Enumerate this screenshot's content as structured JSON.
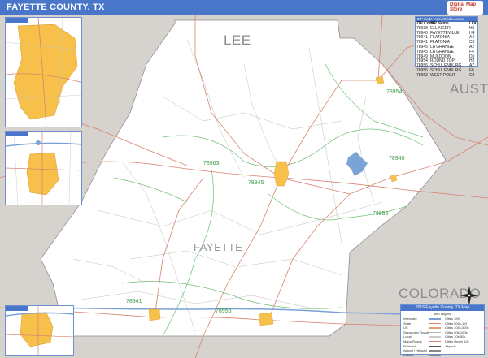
{
  "header": {
    "title": "FAYETTE COUNTY, TX"
  },
  "logo": {
    "text": "Digital Map Store"
  },
  "regions": [
    {
      "name": "LEE"
    },
    {
      "name": "AUSTIN"
    },
    {
      "name": "COLORADO"
    }
  ],
  "county": {
    "name": "FAYETTE"
  },
  "zip_codes_on_map": [
    "78954",
    "78963",
    "78945",
    "78940",
    "78956",
    "78941",
    "78956"
  ],
  "zip_table": {
    "title": "ZIP Code Index/Grid Locator",
    "headers": [
      "ZIP Code",
      "ZIP Name",
      "LOC"
    ],
    "rows": [
      [
        "78938",
        "ELLINGER",
        "H5"
      ],
      [
        "78940",
        "FAYETTEVILLE",
        "H4"
      ],
      [
        "78941",
        "FLATONIA",
        "A4"
      ],
      [
        "78941",
        "FLATONIA",
        "C6"
      ],
      [
        "78945",
        "LA GRANGE",
        "A2"
      ],
      [
        "78945",
        "LA GRANGE",
        "F4"
      ],
      [
        "78949",
        "MULDOON",
        "D5"
      ],
      [
        "78954",
        "ROUND TOP",
        "H2"
      ],
      [
        "78956",
        "SCHULENBURG",
        "A7"
      ],
      [
        "78956",
        "SCHULENBURG",
        "F6"
      ],
      [
        "78963",
        "WEST POINT",
        "G4"
      ]
    ]
  },
  "legend": {
    "title": "2016 Fayette County, TX Map",
    "subtitle": "Map Legend",
    "left_items": [
      "Interstate",
      "State",
      "US",
      "Secondary Roads",
      "Local",
      "Major Roads",
      "Railroad",
      "Airport / Helipad",
      "Airfield"
    ],
    "right_items": [
      "Cities 1M+",
      "Cities 500k-1M",
      "Cities 100k-500k",
      "Cities 50k-100k",
      "Cities 10k-50k",
      "Cities Under 10k",
      "Airports"
    ]
  },
  "colors": {
    "title_bar": "#4a76c9",
    "county_fill": "#ffffff",
    "outside": "#d6d3cf",
    "city": "#f7c04a",
    "road_major": "#d9826f",
    "road_minor": "#b9b9b9",
    "zip_boundary": "#6fbf6f",
    "water": "#7ba3d6"
  },
  "icons": {
    "compass": "compass-rose-icon"
  }
}
